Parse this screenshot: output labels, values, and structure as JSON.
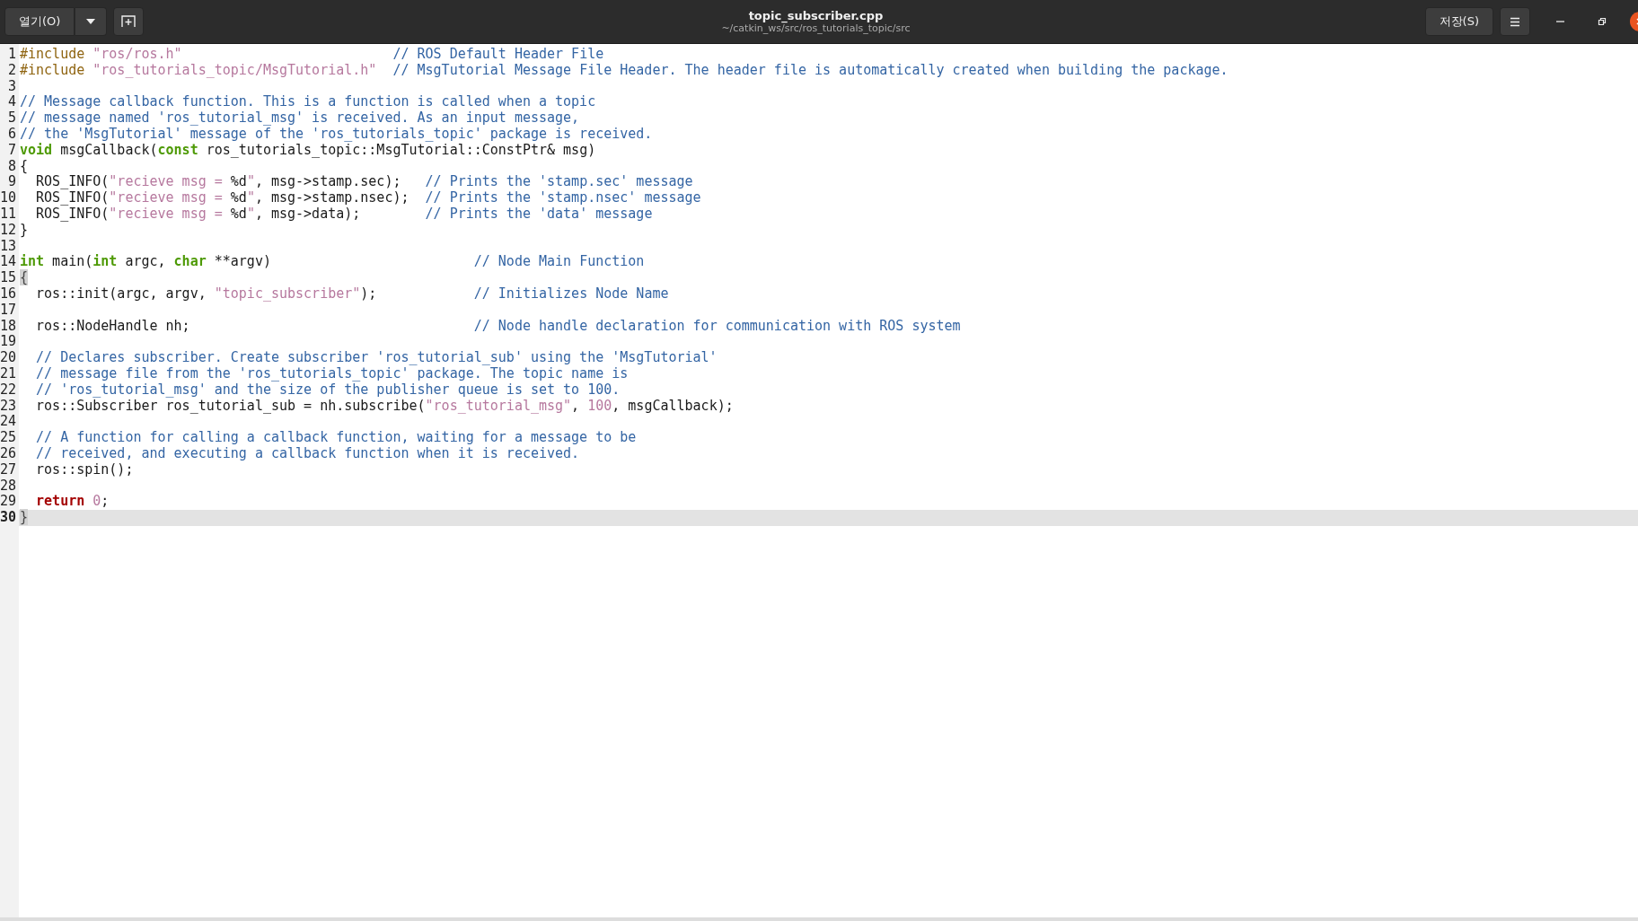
{
  "header": {
    "open_button": "열기(O)",
    "title": "topic_subscriber.cpp",
    "subtitle": "~/catkin_ws/src/ros_tutorials_topic/src",
    "save_button": "저장(S)"
  },
  "editor": {
    "lines": [
      {
        "number": "1",
        "current": false,
        "tokens": [
          {
            "kind": "preproc",
            "text": "#include "
          },
          {
            "kind": "string",
            "text": "\"ros/ros.h\""
          },
          {
            "kind": "comment",
            "text": "                          // ROS Default Header File"
          }
        ]
      },
      {
        "number": "2",
        "current": false,
        "tokens": [
          {
            "kind": "preproc",
            "text": "#include "
          },
          {
            "kind": "string",
            "text": "\"ros_tutorials_topic/MsgTutorial.h\""
          },
          {
            "kind": "comment",
            "text": "  // MsgTutorial Message File Header. The header file is automatically created when building the package."
          }
        ]
      },
      {
        "number": "3",
        "current": false
      },
      {
        "number": "4",
        "current": false,
        "tokens": [
          {
            "kind": "comment",
            "text": "// Message callback function. This is a function is called when a topic"
          }
        ]
      },
      {
        "number": "5",
        "current": false,
        "tokens": [
          {
            "kind": "comment",
            "text": "// message named 'ros_tutorial_msg' is received. As an input message,"
          }
        ]
      },
      {
        "number": "6",
        "current": false,
        "tokens": [
          {
            "kind": "comment",
            "text": "// the 'MsgTutorial' message of the 'ros_tutorials_topic' package is received."
          }
        ]
      },
      {
        "number": "7",
        "current": false,
        "tokens": [
          {
            "kind": "type",
            "text": "void"
          },
          {
            "kind": "plain",
            "text": " msgCallback("
          },
          {
            "kind": "type",
            "text": "const"
          },
          {
            "kind": "plain",
            "text": " ros_tutorials_topic::MsgTutorial::ConstPtr& msg)"
          }
        ]
      },
      {
        "number": "8",
        "current": false,
        "tokens": [
          {
            "kind": "plain",
            "text": "{"
          }
        ]
      },
      {
        "number": "9",
        "current": false,
        "tokens": [
          {
            "kind": "plain",
            "text": "  ROS_INFO("
          },
          {
            "kind": "string",
            "text": "\"recieve msg = "
          },
          {
            "kind": "plain",
            "text": "%d"
          },
          {
            "kind": "string",
            "text": "\""
          },
          {
            "kind": "plain",
            "text": ", msg->stamp.sec);   "
          },
          {
            "kind": "comment",
            "text": "// Prints the 'stamp.sec' message"
          }
        ]
      },
      {
        "number": "10",
        "current": false,
        "tokens": [
          {
            "kind": "plain",
            "text": "  ROS_INFO("
          },
          {
            "kind": "string",
            "text": "\"recieve msg = "
          },
          {
            "kind": "plain",
            "text": "%d"
          },
          {
            "kind": "string",
            "text": "\""
          },
          {
            "kind": "plain",
            "text": ", msg->stamp.nsec);  "
          },
          {
            "kind": "comment",
            "text": "// Prints the 'stamp.nsec' message"
          }
        ]
      },
      {
        "number": "11",
        "current": false,
        "tokens": [
          {
            "kind": "plain",
            "text": "  ROS_INFO("
          },
          {
            "kind": "string",
            "text": "\"recieve msg = "
          },
          {
            "kind": "plain",
            "text": "%d"
          },
          {
            "kind": "string",
            "text": "\""
          },
          {
            "kind": "plain",
            "text": ", msg->data);        "
          },
          {
            "kind": "comment",
            "text": "// Prints the 'data' message"
          }
        ]
      },
      {
        "number": "12",
        "current": false,
        "tokens": [
          {
            "kind": "plain",
            "text": "}"
          }
        ]
      },
      {
        "number": "13",
        "current": false
      },
      {
        "number": "14",
        "current": false,
        "tokens": [
          {
            "kind": "type",
            "text": "int"
          },
          {
            "kind": "plain",
            "text": " main("
          },
          {
            "kind": "type",
            "text": "int"
          },
          {
            "kind": "plain",
            "text": " argc, "
          },
          {
            "kind": "type",
            "text": "char"
          },
          {
            "kind": "plain",
            "text": " **argv)                         "
          },
          {
            "kind": "comment",
            "text": "// Node Main Function"
          }
        ]
      },
      {
        "number": "15",
        "current": false,
        "tokens": [
          {
            "kind": "match",
            "text": "{"
          }
        ]
      },
      {
        "number": "16",
        "current": false,
        "tokens": [
          {
            "kind": "plain",
            "text": "  ros::init(argc, argv, "
          },
          {
            "kind": "string",
            "text": "\"topic_subscriber\""
          },
          {
            "kind": "plain",
            "text": ");            "
          },
          {
            "kind": "comment",
            "text": "// Initializes Node Name"
          }
        ]
      },
      {
        "number": "17",
        "current": false
      },
      {
        "number": "18",
        "current": false,
        "tokens": [
          {
            "kind": "plain",
            "text": "  ros::NodeHandle nh;                                   "
          },
          {
            "kind": "comment",
            "text": "// Node handle declaration for communication with ROS system"
          }
        ]
      },
      {
        "number": "19",
        "current": false
      },
      {
        "number": "20",
        "current": false,
        "tokens": [
          {
            "kind": "comment",
            "text": "  // Declares subscriber. Create subscriber 'ros_tutorial_sub' using the 'MsgTutorial'"
          }
        ]
      },
      {
        "number": "21",
        "current": false,
        "tokens": [
          {
            "kind": "comment",
            "text": "  // message file from the 'ros_tutorials_topic' package. The topic name is"
          }
        ]
      },
      {
        "number": "22",
        "current": false,
        "tokens": [
          {
            "kind": "comment",
            "text": "  // 'ros_tutorial_msg' and the size of the publisher queue is set to 100."
          }
        ]
      },
      {
        "number": "23",
        "current": false,
        "tokens": [
          {
            "kind": "plain",
            "text": "  ros::Subscriber ros_tutorial_sub = nh.subscribe("
          },
          {
            "kind": "string",
            "text": "\"ros_tutorial_msg\""
          },
          {
            "kind": "plain",
            "text": ", "
          },
          {
            "kind": "number",
            "text": "100"
          },
          {
            "kind": "plain",
            "text": ", msgCallback);"
          }
        ]
      },
      {
        "number": "24",
        "current": false
      },
      {
        "number": "25",
        "current": false,
        "tokens": [
          {
            "kind": "comment",
            "text": "  // A function for calling a callback function, waiting for a message to be"
          }
        ]
      },
      {
        "number": "26",
        "current": false,
        "tokens": [
          {
            "kind": "comment",
            "text": "  // received, and executing a callback function when it is received."
          }
        ]
      },
      {
        "number": "27",
        "current": false,
        "tokens": [
          {
            "kind": "plain",
            "text": "  ros::spin();"
          }
        ]
      },
      {
        "number": "28",
        "current": false
      },
      {
        "number": "29",
        "current": false,
        "tokens": [
          {
            "kind": "keyword",
            "text": "  return"
          },
          {
            "kind": "number",
            "text": " 0"
          },
          {
            "kind": "plain",
            "text": ";"
          }
        ]
      },
      {
        "number": "30",
        "current": true,
        "tokens": [
          {
            "kind": "match",
            "text": "}"
          }
        ]
      }
    ]
  }
}
